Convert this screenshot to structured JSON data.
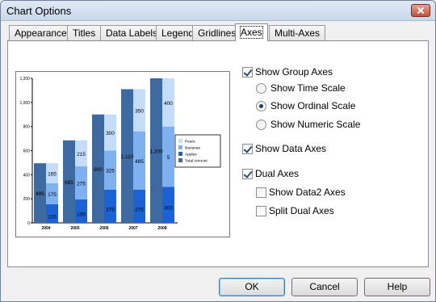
{
  "window": {
    "title": "Chart Options"
  },
  "tabs": [
    {
      "label": "Appearance"
    },
    {
      "label": "Titles"
    },
    {
      "label": "Data Labels"
    },
    {
      "label": "Legend"
    },
    {
      "label": "Gridlines"
    },
    {
      "label": "Axes",
      "active": true
    },
    {
      "label": "Multi-Axes"
    }
  ],
  "options": {
    "show_group_axes": {
      "label": "Show Group Axes",
      "checked": true
    },
    "show_time_scale": {
      "label": "Show Time Scale",
      "checked": false
    },
    "show_ordinal_scale": {
      "label": "Show Ordinal Scale",
      "checked": true
    },
    "show_numeric_scale": {
      "label": "Show Numeric Scale",
      "checked": false
    },
    "show_data_axes": {
      "label": "Show Data Axes",
      "checked": true
    },
    "dual_axes": {
      "label": "Dual Axes",
      "checked": true
    },
    "show_data2_axes": {
      "label": "Show Data2 Axes",
      "checked": false
    },
    "split_dual_axes": {
      "label": "Split Dual Axes",
      "checked": false
    }
  },
  "buttons": {
    "ok": "OK",
    "cancel": "Cancel",
    "help": "Help"
  },
  "colors": {
    "pears": "#c6dcfb",
    "bananas": "#7fb0f0",
    "apples": "#1a63d6",
    "total": "#3d6aa1"
  },
  "chart_data": {
    "type": "bar",
    "categories": [
      "2004",
      "2005",
      "2006",
      "2007",
      "2008"
    ],
    "ylim": [
      0,
      1200
    ],
    "yticks": [
      "0",
      "200",
      "400",
      "600",
      "800",
      "1,000",
      "1,200"
    ],
    "series": [
      {
        "name": "Pears",
        "values": [
          165,
          215,
          300,
          350,
          400
        ]
      },
      {
        "name": "Bananas",
        "values": [
          175,
          275,
          325,
          485,
          500
        ]
      },
      {
        "name": "Apples",
        "values": [
          155,
          195,
          275,
          275,
          300
        ]
      },
      {
        "name": "Total Amount",
        "values": [
          495,
          685,
          900,
          1110,
          1200
        ]
      }
    ],
    "legend": [
      "Pears",
      "Bananas",
      "Apples",
      "Total Amount"
    ],
    "data_labels": {
      "total": [
        "495",
        "685",
        "900",
        "1,110",
        "1,200"
      ],
      "pears": [
        "165",
        "215",
        "300",
        "350",
        "400"
      ],
      "bananas": [
        "175",
        "275",
        "325",
        "485",
        "5"
      ],
      "apples": [
        "155",
        "195",
        "275",
        "275",
        "300"
      ]
    },
    "legend_position": "right",
    "grid": false
  }
}
